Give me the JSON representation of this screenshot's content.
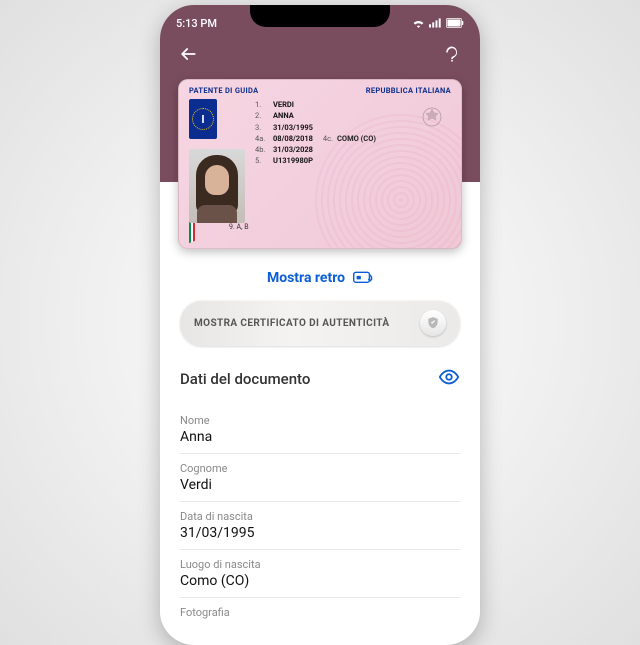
{
  "status": {
    "time": "5:13 PM"
  },
  "license": {
    "header_left": "PATENTE DI GUIDA",
    "header_right": "REPUBBLICA ITALIANA",
    "eu_letter": "I",
    "fields": {
      "f1": {
        "num": "1.",
        "val": "VERDI"
      },
      "f2": {
        "num": "2.",
        "val": "ANNA"
      },
      "f3": {
        "num": "3.",
        "val": "31/03/1995"
      },
      "f4a": {
        "num": "4a.",
        "val": "08/08/2018",
        "extra_num": "4c.",
        "extra_val": "COMO (CO)"
      },
      "f4b": {
        "num": "4b.",
        "val": "31/03/2028"
      },
      "f5": {
        "num": "5.",
        "val": "U1319980P"
      }
    },
    "categories_num": "9.",
    "categories": "A, B"
  },
  "actions": {
    "show_back": "Mostra retro",
    "show_cert": "MOSTRA CERTIFICATO DI AUTENTICITÀ"
  },
  "section": {
    "title": "Dati del documento"
  },
  "details": {
    "nome": {
      "label": "Nome",
      "value": "Anna"
    },
    "cognome": {
      "label": "Cognome",
      "value": "Verdi"
    },
    "dob": {
      "label": "Data di nascita",
      "value": "31/03/1995"
    },
    "pob": {
      "label": "Luogo di nascita",
      "value": "Como (CO)"
    },
    "foto": {
      "label": "Fotografia"
    }
  }
}
